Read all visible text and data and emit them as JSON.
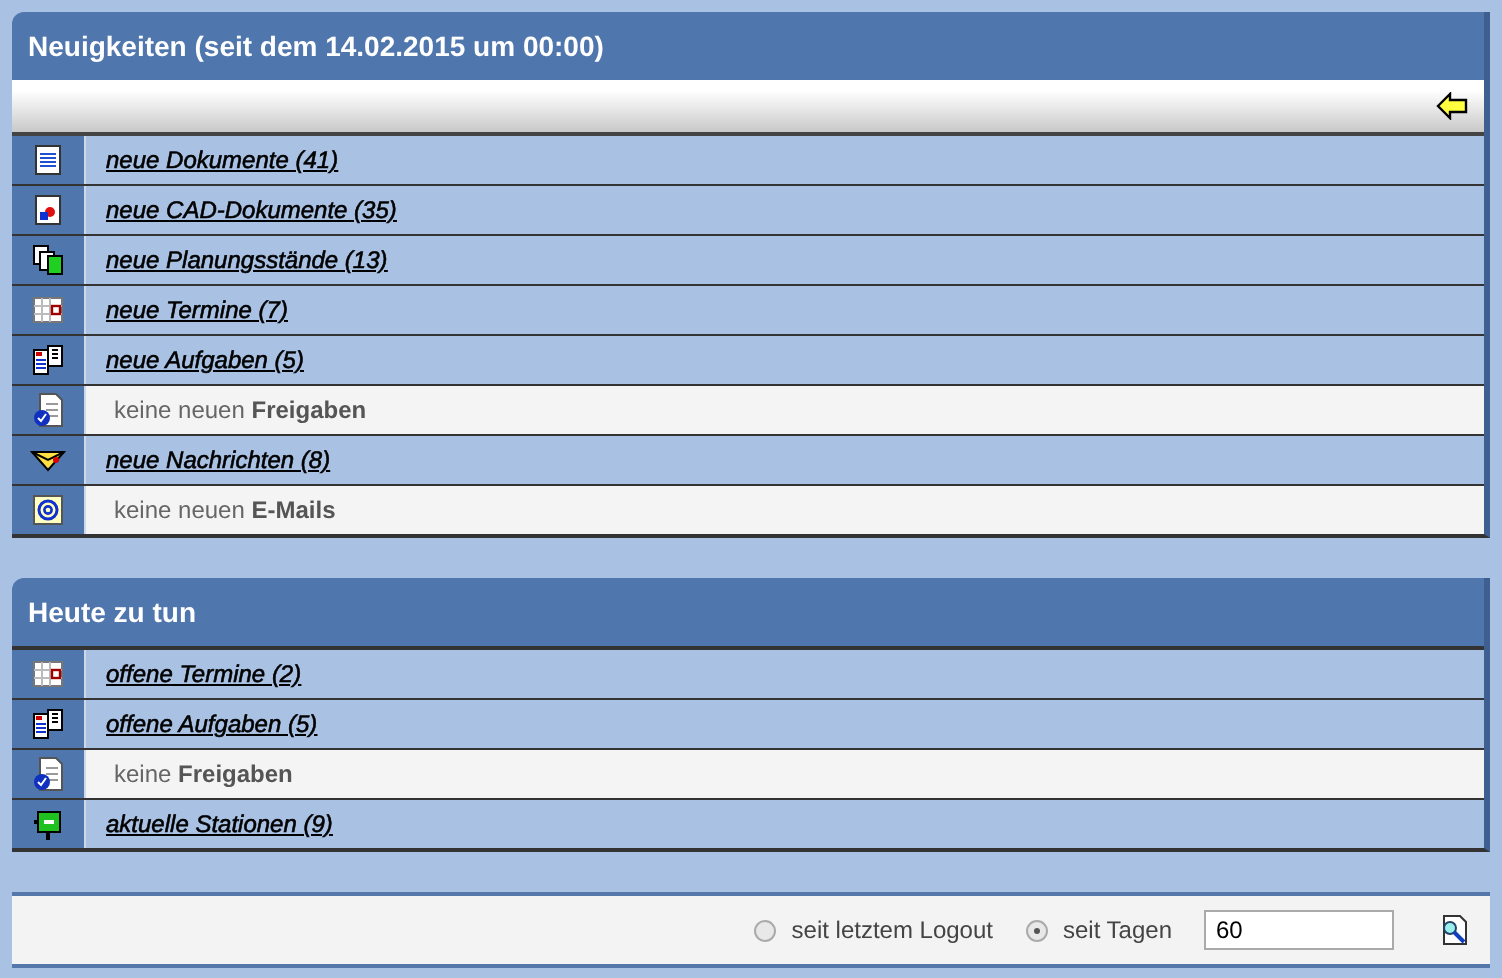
{
  "sections": [
    {
      "title": "Neuigkeiten (seit dem 14.02.2015 um 00:00)",
      "toolbar": true,
      "items": [
        {
          "kind": "link",
          "text": "neue Dokumente (41)"
        },
        {
          "kind": "link",
          "text": "neue CAD-Dokumente (35)"
        },
        {
          "kind": "link",
          "text": "neue Planungsstände (13)"
        },
        {
          "kind": "link",
          "text": "neue Termine (7)"
        },
        {
          "kind": "link",
          "text": "neue Aufgaben (5)"
        },
        {
          "kind": "empty",
          "text": "keine neuen **Freigaben**"
        },
        {
          "kind": "link",
          "text": "neue Nachrichten (8)"
        },
        {
          "kind": "empty",
          "text": "keine neuen **E-Mails**"
        }
      ]
    },
    {
      "title": "Heute zu tun",
      "toolbar": false,
      "items": [
        {
          "kind": "link",
          "text": "offene Termine (2)"
        },
        {
          "kind": "link",
          "text": "offene Aufgaben (5)"
        },
        {
          "kind": "empty",
          "text": "keine **Freigaben**"
        },
        {
          "kind": "link",
          "text": "aktuelle Stationen (9)"
        }
      ]
    }
  ],
  "filter": {
    "options": [
      {
        "label": "seit letztem Logout",
        "selected": false
      },
      {
        "label": "seit Tagen",
        "selected": true
      }
    ],
    "days": "60"
  }
}
